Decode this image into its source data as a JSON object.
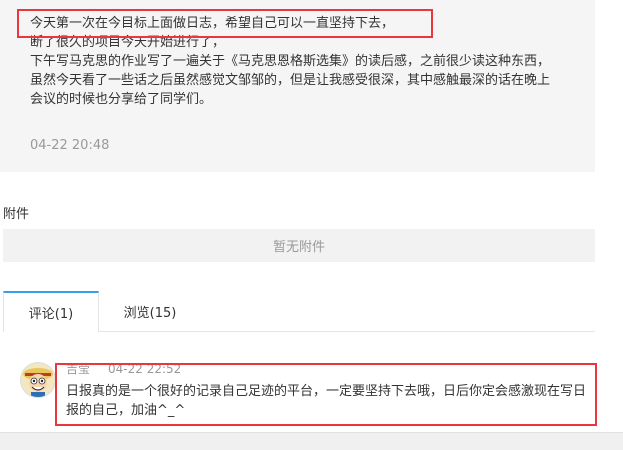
{
  "log": {
    "lines": [
      "今天第一次在今目标上面做日志，希望自己可以一直坚持下去，",
      "断了很久的项目今天开始进行了，",
      "下午写马克思的作业写了一遍关于《马克思恩格斯选集》的读后感，之前很少读这种东西，",
      "虽然今天看了一些话之后虽然感觉文邹邹的，但是让我感受很深，其中感触最深的话在晚上",
      "会议的时候也分享给了同学们。"
    ],
    "time": "04-22 20:48"
  },
  "attachments": {
    "title": "附件",
    "empty_text": "暂无附件"
  },
  "tabs": [
    {
      "label": "评论(1)",
      "active": true
    },
    {
      "label": "浏览(15)",
      "active": false
    }
  ],
  "comment": {
    "author": "吉莹",
    "time": "04-22 22:52",
    "text": "日报真的是一个很好的记录自己足迹的平台，一定要坚持下去哦，日后你定会感激现在写日报的自己，加油^_^",
    "avatar_icon": "avatar-cartoon-icon"
  },
  "colors": {
    "highlight": "#e8383d",
    "tab_accent": "#33a1e8"
  }
}
